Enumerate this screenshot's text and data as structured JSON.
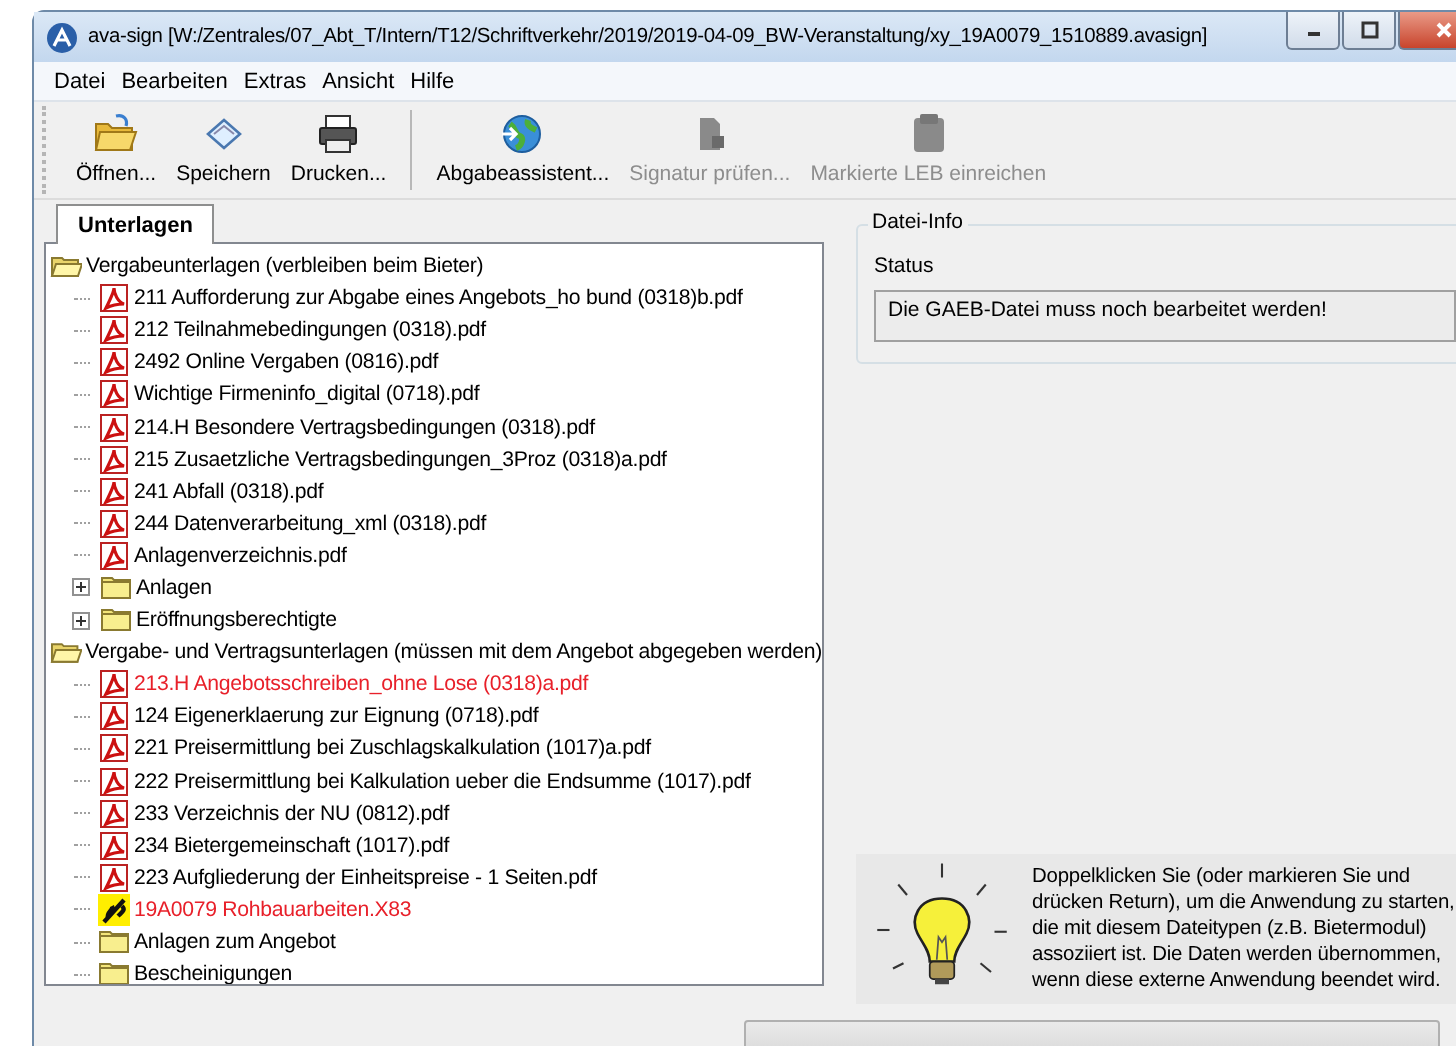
{
  "window": {
    "title": "ava-sign [W:/Zentrales/07_Abt_T/Intern/T12/Schriftverkehr/2019/2019-04-09_BW-Veranstaltung/xy_19A0079_1510889.avasign]"
  },
  "menu": [
    "Datei",
    "Bearbeiten",
    "Extras",
    "Ansicht",
    "Hilfe"
  ],
  "toolbar": [
    {
      "kind": "open",
      "label": "Öffnen...",
      "disabled": false
    },
    {
      "kind": "save",
      "label": "Speichern",
      "disabled": false
    },
    {
      "kind": "print",
      "label": "Drucken...",
      "disabled": false
    },
    {
      "kind": "separator"
    },
    {
      "kind": "assistant",
      "label": "Abgabeassistent...",
      "disabled": false
    },
    {
      "kind": "signature",
      "label": "Signatur prüfen...",
      "disabled": true
    },
    {
      "kind": "leb",
      "label": "Markierte LEB einreichen",
      "disabled": true
    }
  ],
  "tabs": [
    {
      "label": "Unterlagen",
      "selected": true
    }
  ],
  "tree": [
    {
      "kind": "folder",
      "label": "Vergabeunterlagen (verbleiben beim Bieter)",
      "expanded": true,
      "children": [
        {
          "kind": "pdf",
          "label": "211 Aufforderung zur Abgabe eines Angebots_ho bund (0318)b.pdf",
          "marked": false
        },
        {
          "kind": "pdf",
          "label": "212 Teilnahmebedingungen (0318).pdf",
          "marked": false
        },
        {
          "kind": "pdf",
          "label": "2492 Online Vergaben (0816).pdf",
          "marked": false
        },
        {
          "kind": "pdf",
          "label": "Wichtige Firmeninfo_digital (0718).pdf",
          "marked": false
        },
        {
          "kind": "pdf",
          "label": "214.H Besondere Vertragsbedingungen (0318).pdf",
          "marked": false
        },
        {
          "kind": "pdf",
          "label": "215 Zusaetzliche Vertragsbedingungen_3Proz (0318)a.pdf",
          "marked": false
        },
        {
          "kind": "pdf",
          "label": "241 Abfall (0318).pdf",
          "marked": false
        },
        {
          "kind": "pdf",
          "label": "244 Datenverarbeitung_xml (0318).pdf",
          "marked": false
        },
        {
          "kind": "pdf",
          "label": "Anlagenverzeichnis.pdf",
          "marked": false
        },
        {
          "kind": "folder",
          "label": "Anlagen",
          "expanded": false
        },
        {
          "kind": "folder",
          "label": "Eröffnungsberechtigte",
          "expanded": false
        }
      ]
    },
    {
      "kind": "folder",
      "label": "Vergabe- und Vertragsunterlagen (müssen mit dem Angebot abgegeben werden)",
      "expanded": true,
      "children": [
        {
          "kind": "pdf",
          "label": "213.H Angebotsschreiben_ohne Lose (0318)a.pdf",
          "marked": true
        },
        {
          "kind": "pdf",
          "label": "124 Eigenerklaerung zur Eignung (0718).pdf",
          "marked": false
        },
        {
          "kind": "pdf",
          "label": "221 Preisermittlung bei Zuschlagskalkulation (1017)a.pdf",
          "marked": false
        },
        {
          "kind": "pdf",
          "label": "222 Preisermittlung bei Kalkulation ueber die Endsumme (1017).pdf",
          "marked": false
        },
        {
          "kind": "pdf",
          "label": "233 Verzeichnis der NU (0812).pdf",
          "marked": false
        },
        {
          "kind": "pdf",
          "label": "234 Bietergemeinschaft (1017).pdf",
          "marked": false
        },
        {
          "kind": "pdf",
          "label": "223 Aufgliederung der Einheitspreise - 1 Seiten.pdf",
          "marked": false
        },
        {
          "kind": "gaeb",
          "label": "19A0079 Rohbauarbeiten.X83",
          "marked": true
        },
        {
          "kind": "folder",
          "label": "Anlagen zum Angebot"
        },
        {
          "kind": "folder",
          "label": "Bescheinigungen"
        }
      ]
    }
  ],
  "file_info": {
    "title": "Datei-Info",
    "status_label": "Status",
    "status": "Die GAEB-Datei muss noch bearbeitet werden!"
  },
  "progress": {
    "level": 0
  },
  "hint": "Doppelklicken Sie (oder markieren Sie und drücken Return), um die Anwendung zu starten, die mit diesem Dateitypen (z.B. Bietermodul) assoziiert ist. Die Daten werden übernommen, wenn diese externe Anwendung beendet wird."
}
